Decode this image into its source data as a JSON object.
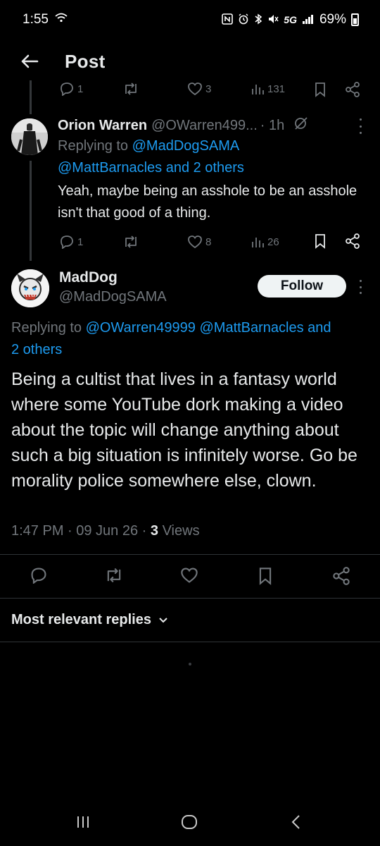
{
  "status_bar": {
    "time": "1:55",
    "battery": "69%",
    "network": "5G"
  },
  "header": {
    "title": "Post"
  },
  "prev_tweet_actions": {
    "replies": "1",
    "reposts": "",
    "likes": "3",
    "views": "131"
  },
  "reply": {
    "name": "Orion Warren",
    "handle": "@OWarren499...",
    "time": "· 1h",
    "replying_prefix": "Replying to",
    "mention1": "@MadDogSAMA",
    "mention2": "@MattBarnacles and 2 others",
    "text": "Yeah, maybe being an asshole to be an asshole isn't that good of a thing.",
    "actions": {
      "replies": "1",
      "likes": "8",
      "views": "26"
    }
  },
  "main_post": {
    "name": "MadDog",
    "handle": "@MadDogSAMA",
    "follow_label": "Follow",
    "replying_prefix": "Replying to",
    "mention_line": "@OWarren49999 @MattBarnacles and",
    "mention_line2": "2 others",
    "text": "Being a cultist that lives in a fantasy world where some YouTube dork making a video about the topic will change anything about such a big situation is infinitely worse. Go be morality police somewhere else, clown.",
    "timestamp": "1:47 PM · 09 Jun 26 ·",
    "views_count": "3",
    "views_label": "Views"
  },
  "replies_section": {
    "label": "Most relevant replies"
  },
  "colors": {
    "background": "#000000",
    "text": "#e7e9ea",
    "muted": "#71767b",
    "link": "#1d9bf0",
    "divider": "#2f3336"
  }
}
